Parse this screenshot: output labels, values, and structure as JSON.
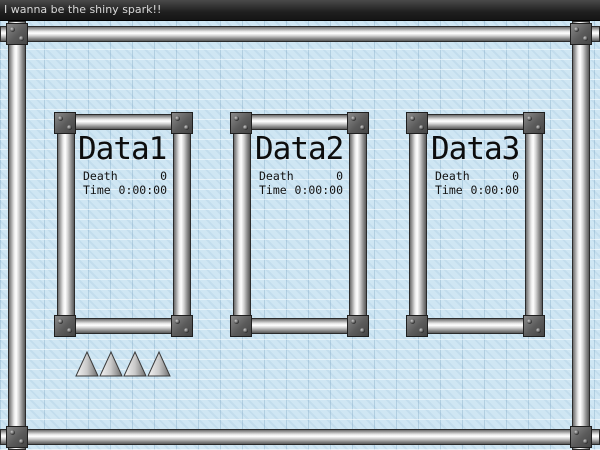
{
  "window": {
    "title": "I wanna be the shiny spark!!"
  },
  "slots": [
    {
      "title": "Data1",
      "death_label": "Death",
      "death_value": "0",
      "time_label": "Time",
      "time_value": "0:00:00"
    },
    {
      "title": "Data2",
      "death_label": "Death",
      "death_value": "0",
      "time_label": "Time",
      "time_value": "0:00:00"
    },
    {
      "title": "Data3",
      "death_label": "Death",
      "death_value": "0",
      "time_label": "Time",
      "time_value": "0:00:00"
    }
  ],
  "decor": {
    "spikes_count": 4,
    "background_color": "#cfe6f3",
    "pipe_color": "#c8c8c8"
  }
}
